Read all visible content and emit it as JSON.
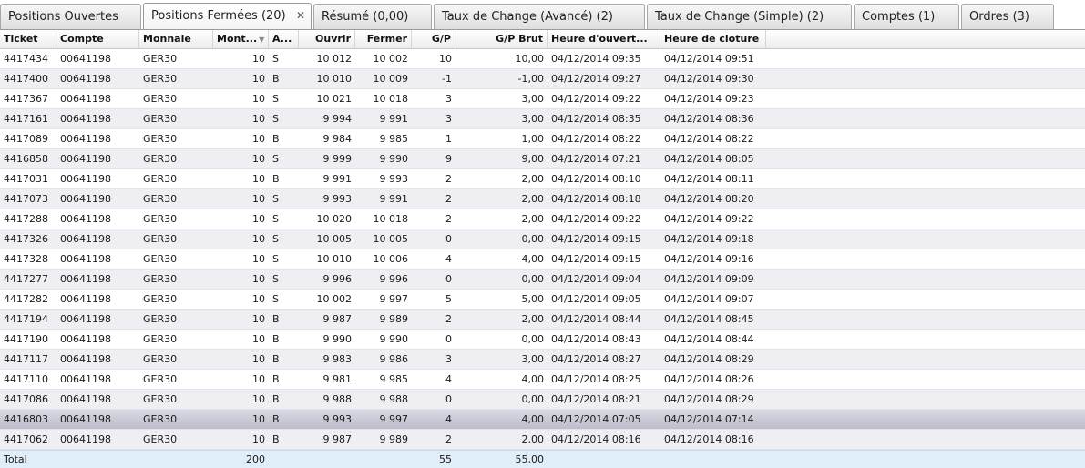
{
  "tabs": [
    {
      "label": "Positions Ouvertes"
    },
    {
      "label": "Positions Fermées (20)"
    },
    {
      "label": "Résumé (0,00)"
    },
    {
      "label": "Taux de Change (Avancé) (2)"
    },
    {
      "label": "Taux de Change (Simple) (2)"
    },
    {
      "label": "Comptes (1)"
    },
    {
      "label": "Ordres (3)"
    }
  ],
  "close_glyph": "✕",
  "sort_glyph": "▼",
  "columns": {
    "ticket": "Ticket",
    "compte": "Compte",
    "monnaie": "Monnaie",
    "montant": "Mont...",
    "achat": "A...",
    "ouvrir": "Ouvrir",
    "fermer": "Fermer",
    "gp": "G/P",
    "gp_brut": "G/P Brut",
    "heure_ouverture": "Heure d'ouvert...",
    "heure_cloture": "Heure de cloture"
  },
  "rows": [
    [
      "4417434",
      "00641198",
      "GER30",
      "10",
      "S",
      "10 012",
      "10 002",
      "10",
      "10,00",
      "04/12/2014 09:35",
      "04/12/2014 09:51"
    ],
    [
      "4417400",
      "00641198",
      "GER30",
      "10",
      "B",
      "10 010",
      "10 009",
      "-1",
      "-1,00",
      "04/12/2014 09:27",
      "04/12/2014 09:30"
    ],
    [
      "4417367",
      "00641198",
      "GER30",
      "10",
      "S",
      "10 021",
      "10 018",
      "3",
      "3,00",
      "04/12/2014 09:22",
      "04/12/2014 09:23"
    ],
    [
      "4417161",
      "00641198",
      "GER30",
      "10",
      "S",
      "9 994",
      "9 991",
      "3",
      "3,00",
      "04/12/2014 08:35",
      "04/12/2014 08:36"
    ],
    [
      "4417089",
      "00641198",
      "GER30",
      "10",
      "B",
      "9 984",
      "9 985",
      "1",
      "1,00",
      "04/12/2014 08:22",
      "04/12/2014 08:22"
    ],
    [
      "4416858",
      "00641198",
      "GER30",
      "10",
      "S",
      "9 999",
      "9 990",
      "9",
      "9,00",
      "04/12/2014 07:21",
      "04/12/2014 08:05"
    ],
    [
      "4417031",
      "00641198",
      "GER30",
      "10",
      "B",
      "9 991",
      "9 993",
      "2",
      "2,00",
      "04/12/2014 08:10",
      "04/12/2014 08:11"
    ],
    [
      "4417073",
      "00641198",
      "GER30",
      "10",
      "S",
      "9 993",
      "9 991",
      "2",
      "2,00",
      "04/12/2014 08:18",
      "04/12/2014 08:20"
    ],
    [
      "4417288",
      "00641198",
      "GER30",
      "10",
      "S",
      "10 020",
      "10 018",
      "2",
      "2,00",
      "04/12/2014 09:22",
      "04/12/2014 09:22"
    ],
    [
      "4417326",
      "00641198",
      "GER30",
      "10",
      "S",
      "10 005",
      "10 005",
      "0",
      "0,00",
      "04/12/2014 09:15",
      "04/12/2014 09:18"
    ],
    [
      "4417328",
      "00641198",
      "GER30",
      "10",
      "S",
      "10 010",
      "10 006",
      "4",
      "4,00",
      "04/12/2014 09:15",
      "04/12/2014 09:16"
    ],
    [
      "4417277",
      "00641198",
      "GER30",
      "10",
      "S",
      "9 996",
      "9 996",
      "0",
      "0,00",
      "04/12/2014 09:04",
      "04/12/2014 09:09"
    ],
    [
      "4417282",
      "00641198",
      "GER30",
      "10",
      "S",
      "10 002",
      "9 997",
      "5",
      "5,00",
      "04/12/2014 09:05",
      "04/12/2014 09:07"
    ],
    [
      "4417194",
      "00641198",
      "GER30",
      "10",
      "B",
      "9 987",
      "9 989",
      "2",
      "2,00",
      "04/12/2014 08:44",
      "04/12/2014 08:45"
    ],
    [
      "4417190",
      "00641198",
      "GER30",
      "10",
      "B",
      "9 990",
      "9 990",
      "0",
      "0,00",
      "04/12/2014 08:43",
      "04/12/2014 08:44"
    ],
    [
      "4417117",
      "00641198",
      "GER30",
      "10",
      "B",
      "9 983",
      "9 986",
      "3",
      "3,00",
      "04/12/2014 08:27",
      "04/12/2014 08:29"
    ],
    [
      "4417110",
      "00641198",
      "GER30",
      "10",
      "B",
      "9 981",
      "9 985",
      "4",
      "4,00",
      "04/12/2014 08:25",
      "04/12/2014 08:26"
    ],
    [
      "4417086",
      "00641198",
      "GER30",
      "10",
      "B",
      "9 988",
      "9 988",
      "0",
      "0,00",
      "04/12/2014 08:21",
      "04/12/2014 08:29"
    ],
    [
      "4416803",
      "00641198",
      "GER30",
      "10",
      "B",
      "9 993",
      "9 997",
      "4",
      "4,00",
      "04/12/2014 07:05",
      "04/12/2014 07:14"
    ],
    [
      "4417062",
      "00641198",
      "GER30",
      "10",
      "B",
      "9 987",
      "9 989",
      "2",
      "2,00",
      "04/12/2014 08:16",
      "04/12/2014 08:16"
    ]
  ],
  "total": {
    "label": "Total",
    "montant": "200",
    "gp": "55",
    "gp_brut": "55,00"
  }
}
